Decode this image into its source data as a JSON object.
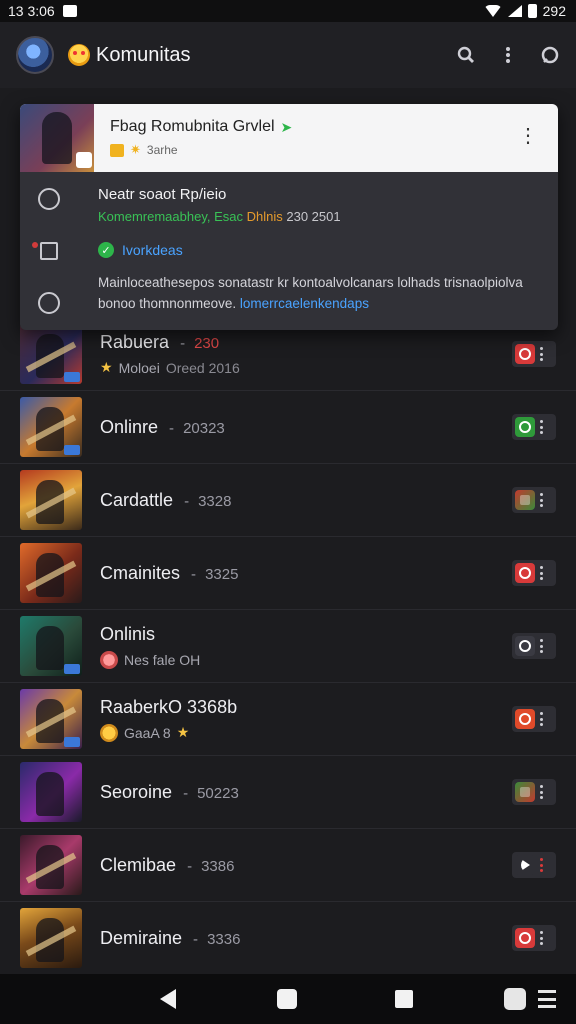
{
  "status_bar": {
    "time": "13 3:06",
    "right_text": "292"
  },
  "app_bar": {
    "title": "Komunitas"
  },
  "popup": {
    "title": "Fbag Romubnita Grvlel",
    "subtitle": "3arhe",
    "heading": "Neatr soaot Rp/ieio",
    "meta_green": "Komemremaabhey, Esac",
    "meta_orange": "Dhlnis",
    "meta_num": "230 2501",
    "tag": "Ivorkdeas",
    "desc": "Mainloceathesepos sonatastr kr kontoalvolcanars lolhads trisnaolpiolva bonoo thomnonmeove.",
    "desc_link": "lomerrcaelenkendaps"
  },
  "rows": [
    {
      "title": "Rabuera",
      "sep": "-",
      "num": "230",
      "sub": "Moloei",
      "sub2": "Oreed 2016"
    },
    {
      "title": "Onlinre",
      "sep": "-",
      "num": "20323",
      "sub": "",
      "sub2": ""
    },
    {
      "title": "Cardattle",
      "sep": "-",
      "num": "3328",
      "sub": "",
      "sub2": ""
    },
    {
      "title": "Cmainites",
      "sep": "-",
      "num": "3325",
      "sub": "",
      "sub2": ""
    },
    {
      "title": "Onlinis",
      "sep": "",
      "num": "",
      "sub": "Nes fale OH",
      "sub2": ""
    },
    {
      "title": "RaaberkO 3368b",
      "sep": "",
      "num": "",
      "sub": "GaaA 8",
      "sub2": ""
    },
    {
      "title": "Seoroine",
      "sep": "-",
      "num": "50223",
      "sub": "",
      "sub2": ""
    },
    {
      "title": "Clemibae",
      "sep": "-",
      "num": "3386",
      "sub": "",
      "sub2": ""
    },
    {
      "title": "Demiraine",
      "sep": "-",
      "num": "3336",
      "sub": "",
      "sub2": ""
    }
  ],
  "colors": {
    "accent_green": "#2db54a",
    "link_blue": "#4aa3ff",
    "action_red": "#d83a3a",
    "action_green": "#2f9a3a"
  },
  "icons": [
    "search-icon",
    "more-vert-icon",
    "chat-icon",
    "back-icon",
    "home-icon",
    "recents-icon"
  ]
}
